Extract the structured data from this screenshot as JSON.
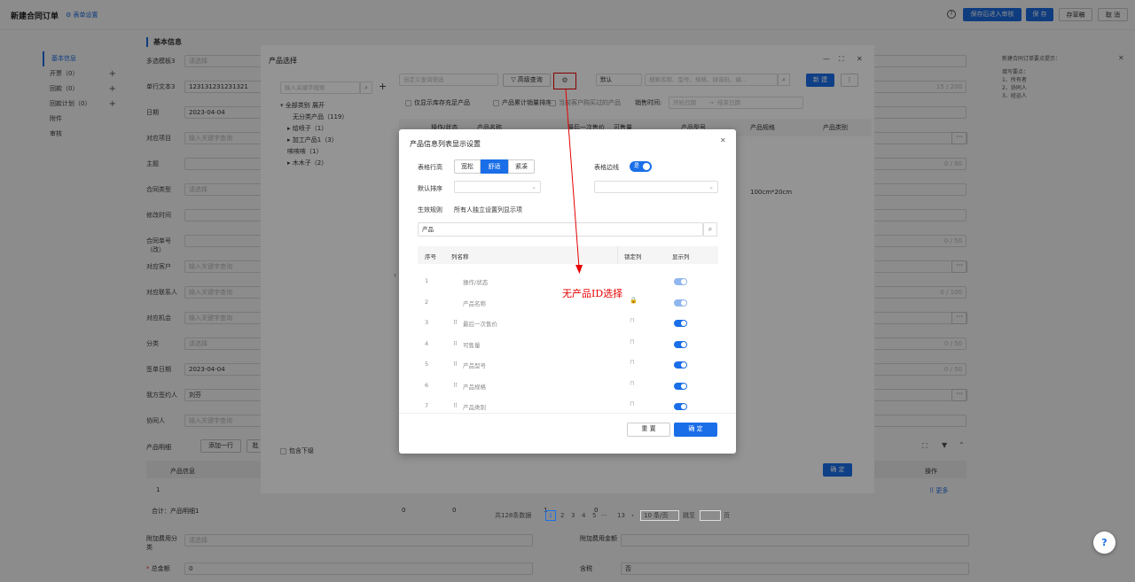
{
  "header": {
    "title": "新建合同订单",
    "settings_link": "表单设置",
    "buttons": [
      "保存后进入审核",
      "保 存",
      "存草稿",
      "取 消"
    ]
  },
  "nav": [
    {
      "label": "基本信息"
    },
    {
      "label": "开票（0）"
    },
    {
      "label": "回款（0）"
    },
    {
      "label": "回款计划（0）"
    },
    {
      "label": "附件"
    },
    {
      "label": "审核"
    }
  ],
  "form": {
    "section_title": "基本信息",
    "fields": [
      {
        "label": "多选模板3",
        "value": "请选择",
        "ph": true
      },
      {
        "label": "单行文本3",
        "value": "123131231231321",
        "ph": false,
        "right": "15 / 200"
      },
      {
        "label": "日期",
        "value": "2023-04-04",
        "ph": false
      },
      {
        "label": "对应项目",
        "value": "输入关键字查询",
        "ph": true,
        "dots": true
      },
      {
        "label": "主题",
        "value": "",
        "ph": true,
        "right": "0 / 80"
      },
      {
        "label": "合同类型",
        "value": "请选择",
        "ph": true
      },
      {
        "label": "修改时间",
        "value": "",
        "ph": true
      },
      {
        "label": "合同单号（改）",
        "value": "",
        "ph": true,
        "right": "0 / 50"
      },
      {
        "label": "对应客户",
        "value": "输入关键字查询",
        "ph": true,
        "dots": true
      },
      {
        "label": "对应联系人",
        "value": "输入关键字查询",
        "ph": true,
        "right": "0 / 100"
      },
      {
        "label": "对应机会",
        "value": "输入关键字查询",
        "ph": true,
        "dots": true
      },
      {
        "label": "分类",
        "value": "请选择",
        "ph": true,
        "right": "0 / 50"
      },
      {
        "label": "签单日期",
        "value": "2023-04-04",
        "ph": false,
        "right": "0 / 50"
      },
      {
        "label": "我方签约人",
        "value": "刘芬",
        "ph": false,
        "dots": true
      },
      {
        "label": "协同人",
        "value": "输入关键字查询",
        "ph": true
      }
    ]
  },
  "product_detail": {
    "title": "产品明细",
    "add_row": "添加一行",
    "batch": "批",
    "col_info": "产品信息",
    "col_op": "操作",
    "op_row": "更多",
    "row_num": "1",
    "total": "合计：产品明细1",
    "sum0": "0",
    "sum1": "0",
    "sum2": "1",
    "sum3": "0"
  },
  "bottom_fields": {
    "extra_cost_label": "附加费用分类",
    "extra_cost_ph": "请选择",
    "extra_amount_label": "附加费用金额",
    "total_label": "总金额",
    "total_val": "0",
    "tax_label": "含税",
    "tax_val": "否"
  },
  "tips": {
    "title": "新建合同订单要点提示：",
    "lines": [
      "填写要点：",
      "1、所有者",
      "2、协同人",
      "3、经运人"
    ]
  },
  "product_modal": {
    "title": "产品选择",
    "tree_search_ph": "输入关键字搜索",
    "tree": [
      {
        "label": "全部类别 展开"
      },
      {
        "label": "无分类产品（119）"
      },
      {
        "label": "▸ 给喷子（1）"
      },
      {
        "label": "▸ 加工产品1（3）"
      },
      {
        "label": "  咳咳咳（1）"
      },
      {
        "label": "▸ 木木子（2）"
      }
    ],
    "include_sub": "包含下级",
    "custom_query_ph": "自定义查询筛选",
    "advanced_query": "高级查询",
    "sort_default": "默认",
    "search_ph": "搜索名称、型号、规格、拼音码、编…",
    "new_btn": "新 建",
    "opt_stock": "仅显示库存充足产品",
    "opt_sales": "产品累计销量排序",
    "opt_customer": "当前客户购买过的产品",
    "sale_time_label": "销售时间:",
    "start_date": "开始日期",
    "end_date": "结束日期",
    "columns": [
      "操作/状态",
      "产品名称",
      "最后一次售价",
      "可售量",
      "产品型号",
      "产品规格",
      "产品类别"
    ],
    "spec_cell": "100cm*20cm",
    "pagination": {
      "total": "共128条数据",
      "pages": [
        "1",
        "2",
        "3",
        "4",
        "5",
        "···",
        "13"
      ],
      "per_page": "10 条/页",
      "jump": "跳至",
      "page_unit": "页"
    },
    "confirm": "确 定"
  },
  "settings_modal": {
    "title": "产品信息列表显示设置",
    "row_height_label": "表格行高",
    "row_heights": [
      "宽松",
      "舒适",
      "紧凑"
    ],
    "border_label": "表格边线",
    "border_on": "是",
    "default_sort_label": "默认排序",
    "rule_label": "生效规则",
    "rule_value": "所有人独立设置列显示项",
    "search_value": "产品",
    "headers": [
      "序号",
      "列名称",
      "锁定列",
      "显示列"
    ],
    "rows": [
      {
        "n": "1",
        "name": "操作/状态",
        "drag": false,
        "locked": false,
        "lock_visible": false,
        "light": true
      },
      {
        "n": "2",
        "name": "产品名称",
        "drag": false,
        "locked": true,
        "lock_visible": true,
        "light": true
      },
      {
        "n": "3",
        "name": "最后一次售价",
        "drag": true,
        "locked": false,
        "lock_visible": true,
        "light": false
      },
      {
        "n": "4",
        "name": "可售量",
        "drag": true,
        "locked": false,
        "lock_visible": true,
        "light": false
      },
      {
        "n": "5",
        "name": "产品型号",
        "drag": true,
        "locked": false,
        "lock_visible": true,
        "light": false
      },
      {
        "n": "6",
        "name": "产品规格",
        "drag": true,
        "locked": false,
        "lock_visible": true,
        "light": false
      },
      {
        "n": "7",
        "name": "产品类别",
        "drag": true,
        "locked": false,
        "lock_visible": true,
        "light": false
      }
    ],
    "reset": "重 置",
    "confirm": "确 定"
  },
  "annotation": "无产品ID选择",
  "colors": {
    "accent": "#1a6ee8",
    "annotation": "#e60000"
  }
}
